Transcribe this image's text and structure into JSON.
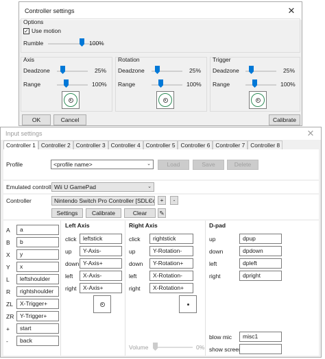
{
  "controller_settings": {
    "title": "Controller settings",
    "options": {
      "heading": "Options",
      "use_motion": "Use motion",
      "use_motion_checked": true,
      "rumble_label": "Rumble",
      "rumble_value": "100%"
    },
    "groups": [
      {
        "title": "Axis",
        "deadzone_label": "Deadzone",
        "deadzone_value": "25%",
        "range_label": "Range",
        "range_value": "100%"
      },
      {
        "title": "Rotation",
        "deadzone_label": "Deadzone",
        "deadzone_value": "25%",
        "range_label": "Range",
        "range_value": "100%"
      },
      {
        "title": "Trigger",
        "deadzone_label": "Deadzone",
        "deadzone_value": "25%",
        "range_label": "Range",
        "range_value": "100%"
      }
    ],
    "buttons": {
      "ok": "OK",
      "cancel": "Cancel",
      "calibrate": "Calibrate"
    }
  },
  "input_settings": {
    "title": "Input settings",
    "tabs": [
      "Controller 1",
      "Controller 2",
      "Controller 3",
      "Controller 4",
      "Controller 5",
      "Controller 6",
      "Controller 7",
      "Controller 8"
    ],
    "selected_tab": 0,
    "profile": {
      "label": "Profile",
      "placeholder": "<profile name>",
      "load": "Load",
      "save": "Save",
      "delete": "Delete"
    },
    "emulated": {
      "label": "Emulated controller",
      "value": "Wii U GamePad"
    },
    "controller": {
      "label": "Controller",
      "value": "Nintendo Switch Pro Controller [SDLCont",
      "add": "+",
      "remove": "-",
      "settings": "Settings",
      "calibrate": "Calibrate",
      "clear": "Clear"
    },
    "buttons_map": [
      {
        "key": "A",
        "value": "a"
      },
      {
        "key": "B",
        "value": "b"
      },
      {
        "key": "X",
        "value": "y"
      },
      {
        "key": "Y",
        "value": "x"
      },
      {
        "key": "L",
        "value": "leftshoulder"
      },
      {
        "key": "R",
        "value": "rightshoulder"
      },
      {
        "key": "ZL",
        "value": "X-Trigger+"
      },
      {
        "key": "ZR",
        "value": "Y-Trigger+"
      },
      {
        "key": "+",
        "value": "start"
      },
      {
        "key": "-",
        "value": "back"
      }
    ],
    "left_axis": {
      "title": "Left Axis",
      "rows": [
        {
          "key": "click",
          "value": "leftstick"
        },
        {
          "key": "up",
          "value": "Y-Axis-"
        },
        {
          "key": "down",
          "value": "Y-Axis+"
        },
        {
          "key": "left",
          "value": "X-Axis-"
        },
        {
          "key": "right",
          "value": "X-Axis+"
        }
      ]
    },
    "right_axis": {
      "title": "Right Axis",
      "rows": [
        {
          "key": "click",
          "value": "rightstick"
        },
        {
          "key": "up",
          "value": "Y-Rotation-"
        },
        {
          "key": "down",
          "value": "Y-Rotation+"
        },
        {
          "key": "left",
          "value": "X-Rotation-"
        },
        {
          "key": "right",
          "value": "X-Rotation+"
        }
      ],
      "volume_label": "Volume",
      "volume_value": "0%"
    },
    "dpad": {
      "title": "D-pad",
      "rows": [
        {
          "key": "up",
          "value": "dpup"
        },
        {
          "key": "down",
          "value": "dpdown"
        },
        {
          "key": "left",
          "value": "dpleft"
        },
        {
          "key": "right",
          "value": "dpright"
        }
      ]
    },
    "blow_mic": {
      "label": "blow mic",
      "value": "misc1"
    },
    "show_screen": {
      "label": "show screen",
      "value": ""
    }
  },
  "colors": {
    "accent": "#0078d7",
    "window_bg": "#f0f0f0",
    "stick_circle": "#2e8b57"
  },
  "icons": {
    "close": "close-icon",
    "edit": "pen-icon",
    "dropdown": "chevron-down-icon"
  }
}
